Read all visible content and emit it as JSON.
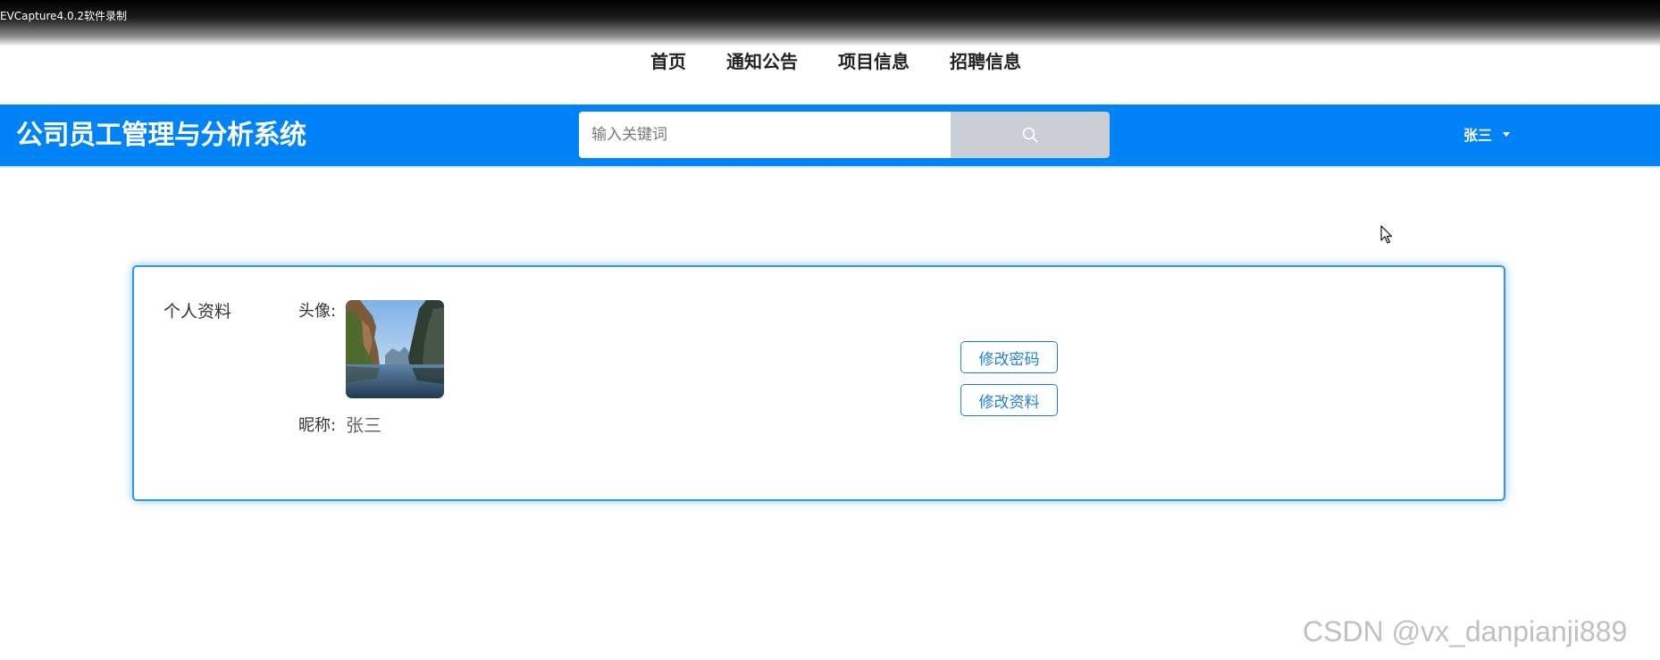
{
  "recording_banner": {
    "text": "EVCapture4.0.2软件录制"
  },
  "nav": {
    "items": [
      {
        "label": "首页"
      },
      {
        "label": "通知公告"
      },
      {
        "label": "项目信息"
      },
      {
        "label": "招聘信息"
      }
    ]
  },
  "header": {
    "site_title": "公司员工管理与分析系统",
    "search": {
      "placeholder": "输入关键词",
      "value": "",
      "button_icon": "search-icon"
    },
    "user": {
      "name": "张三",
      "dropdown_icon": "caret-down-icon"
    }
  },
  "profile": {
    "section_title": "个人资料",
    "avatar_label": "头像:",
    "nickname_label": "昵称:",
    "nickname_value": "张三",
    "change_password_button": "修改密码",
    "edit_profile_button": "修改资料"
  },
  "watermark": {
    "text": "CSDN @vx_danpianji889"
  },
  "colors": {
    "header_blue": "#0083f7",
    "search_button_gray": "#c9ced4",
    "card_border": "#2f95f1",
    "button_text": "#1f7fd6"
  }
}
